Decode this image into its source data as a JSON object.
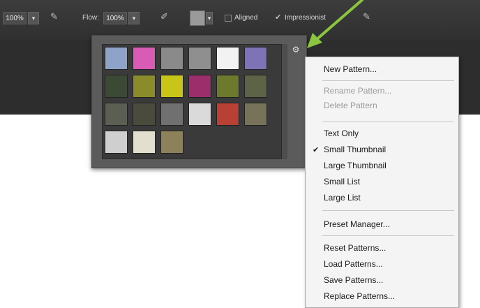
{
  "toolbar": {
    "opacity_value": "100%",
    "flow_label": "Flow:",
    "flow_value": "100%",
    "aligned_label": "Aligned",
    "impressionist_label": "Impressionist"
  },
  "pattern_picker": {
    "swatch_colors": [
      "#8fa2c8",
      "#d85cb6",
      "#8a8a8a",
      "#8f8f8f",
      "#f2f2f2",
      "#7d73b6",
      "#3c4a35",
      "#8a8b2a",
      "#c9c418",
      "#9c2f6b",
      "#6d7a2d",
      "#5c6347",
      "#5b5e52",
      "#4a4a3d",
      "#707070",
      "#dadada",
      "#b84035",
      "#77735a",
      "#cfcfcf",
      "#e3dfcf",
      "#8c8158"
    ]
  },
  "menu": {
    "items": [
      {
        "label": "New Pattern...",
        "disabled": false,
        "checked": false
      },
      {
        "label": "Rename Pattern...",
        "disabled": true,
        "checked": false
      },
      {
        "label": "Delete Pattern",
        "disabled": true,
        "checked": false
      },
      {
        "label": "Text Only",
        "disabled": false,
        "checked": false
      },
      {
        "label": "Small Thumbnail",
        "disabled": false,
        "checked": true
      },
      {
        "label": "Large Thumbnail",
        "disabled": false,
        "checked": false
      },
      {
        "label": "Small List",
        "disabled": false,
        "checked": false
      },
      {
        "label": "Large List",
        "disabled": false,
        "checked": false
      },
      {
        "label": "Preset Manager...",
        "disabled": false,
        "checked": false
      },
      {
        "label": "Reset Patterns...",
        "disabled": false,
        "checked": false
      },
      {
        "label": "Load Patterns...",
        "disabled": false,
        "checked": false
      },
      {
        "label": "Save Patterns...",
        "disabled": false,
        "checked": false
      },
      {
        "label": "Replace Patterns...",
        "disabled": false,
        "checked": false
      }
    ],
    "check_glyph": "✔"
  },
  "colors": {
    "annotation_arrow": "#8cc63f"
  }
}
